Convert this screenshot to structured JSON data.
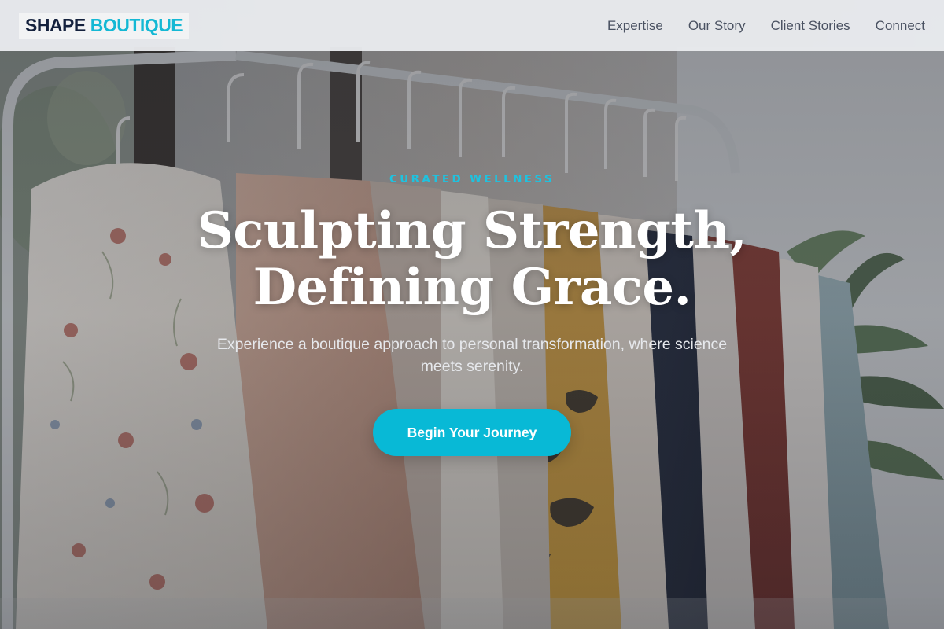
{
  "header": {
    "logo_primary": "SHAPE",
    "logo_accent": "BOUTIQUE",
    "nav": [
      "Expertise",
      "Our Story",
      "Client Stories",
      "Connect"
    ]
  },
  "hero": {
    "eyebrow": "CURATED WELLNESS",
    "headline_line1": "Sculpting Strength,",
    "headline_line2": "Defining Grace.",
    "subtext": "Experience a boutique approach to personal transformation, where science meets serenity.",
    "cta_label": "Begin Your Journey",
    "background_image": "clothing-rack-photo"
  },
  "colors": {
    "accent": "#08b9d6",
    "logo_dark": "#14213d",
    "header_bg": "#e9ebee",
    "nav_text": "#4a5262"
  }
}
